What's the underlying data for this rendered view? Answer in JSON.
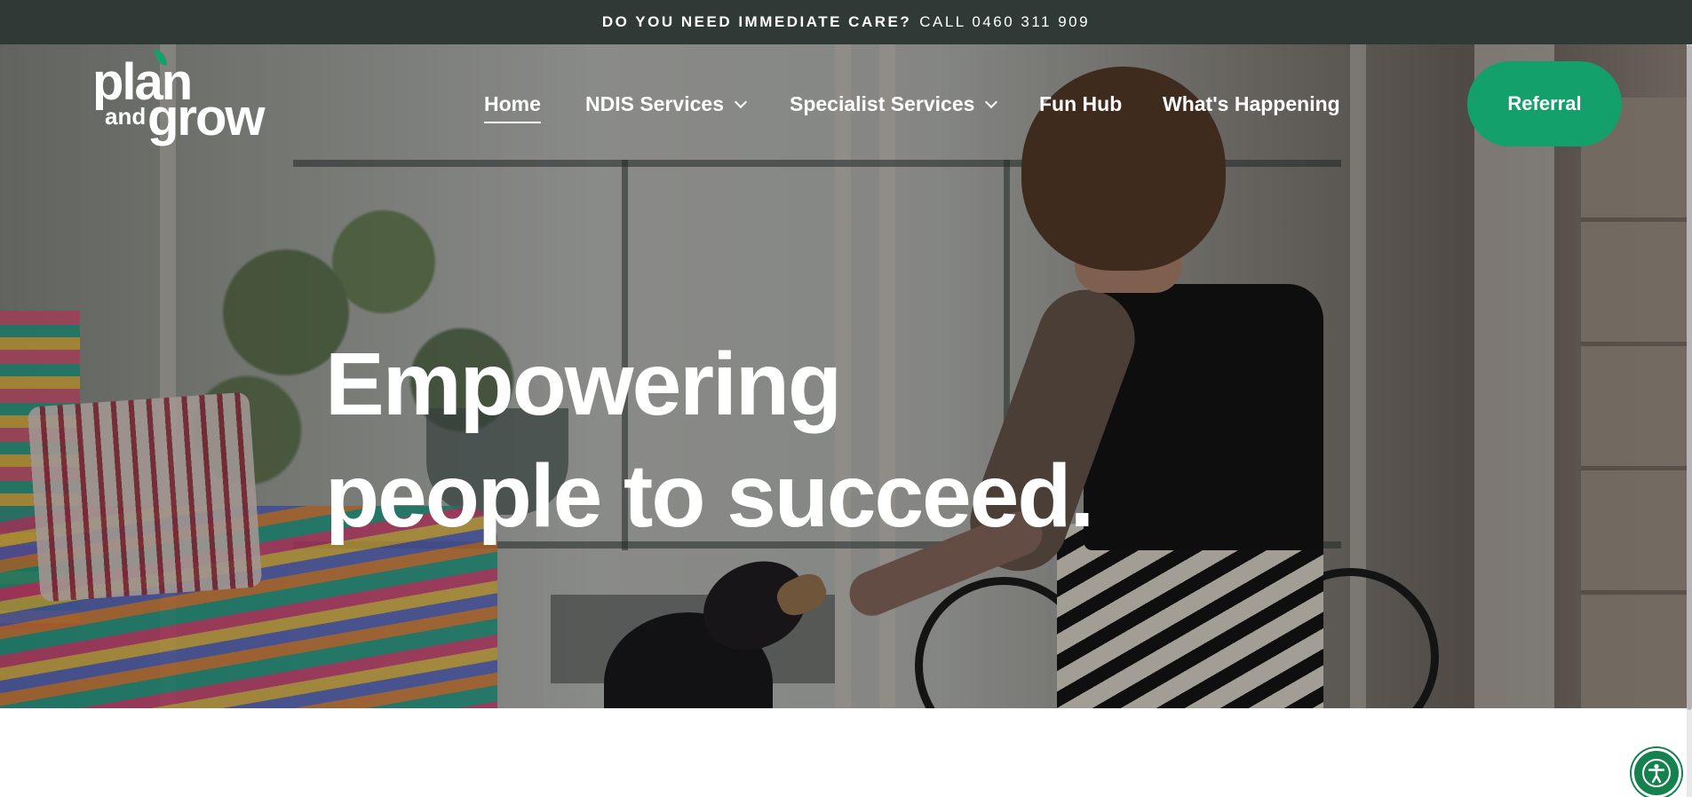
{
  "topbar": {
    "question": "DO YOU NEED IMMEDIATE CARE?",
    "call": "CALL 0460 311 909"
  },
  "logo": {
    "word1": "plan",
    "word2": "and",
    "word3": "grow"
  },
  "nav": {
    "items": [
      {
        "label": "Home",
        "active": true
      },
      {
        "label": "NDIS Services",
        "dropdown": true
      },
      {
        "label": "Specialist Services",
        "dropdown": true
      },
      {
        "label": "Fun Hub"
      },
      {
        "label": "What's Happening"
      }
    ]
  },
  "cta": {
    "referral": "Referral"
  },
  "hero": {
    "line1": "Empowering",
    "line2": "people to succeed."
  },
  "colors": {
    "topbar": "#2f3a36",
    "accent": "#14a06a",
    "accessibility": "#14814e"
  },
  "icons": {
    "accessibility": "accessibility-person-icon",
    "dropdown": "chevron-down-icon"
  }
}
